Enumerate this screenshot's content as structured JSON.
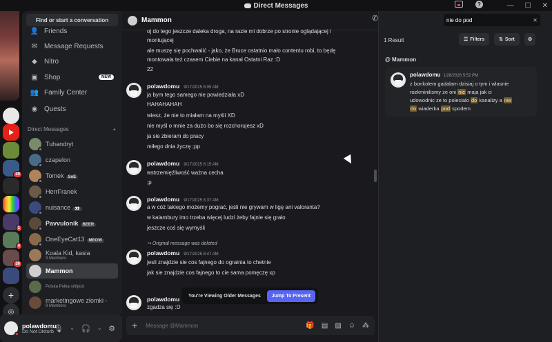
{
  "titlebar": {
    "title": "Direct Messages"
  },
  "sidebar": {
    "find_label": "Find or start a conversation",
    "nav": [
      {
        "label": "Friends",
        "icon": "friends-icon"
      },
      {
        "label": "Message Requests",
        "icon": "mail-icon"
      },
      {
        "label": "Nitro",
        "icon": "nitro-icon"
      },
      {
        "label": "Shop",
        "icon": "shop-icon",
        "badge": "NEW"
      },
      {
        "label": "Family Center",
        "icon": "family-icon"
      },
      {
        "label": "Quests",
        "icon": "quests-icon"
      }
    ],
    "dm_header": "Direct Messages",
    "dm_add": "+",
    "dms": [
      {
        "name": "Tuhandryt",
        "color": "#7a8a6a"
      },
      {
        "name": "czapelon",
        "color": "#4a6a8a"
      },
      {
        "name": "Tomek",
        "tag": "SoE",
        "color": "#b0835a"
      },
      {
        "name": "HerrFranek",
        "color": "#6a5a4a"
      },
      {
        "name": "nuisance",
        "tag": "👀",
        "color": "#3a4a7a"
      },
      {
        "name": "Pavvulonik",
        "tag": "BEER",
        "color": "#5a4a3a"
      },
      {
        "name": "OneEyeCat13",
        "tag": "MEOW",
        "color": "#8a6a4a"
      },
      {
        "name": "Koala Kid, kasia",
        "sub": "3 Members",
        "color": "#9a7a5a"
      },
      {
        "name": "Mammon",
        "color": "#d0d0d0"
      },
      {
        "name": "Polska Polka strilpod",
        "color": "#5a6a4a"
      },
      {
        "name": "marketingowe złomki -",
        "sub": "9 Members",
        "color": "#6a4a3a"
      }
    ]
  },
  "user": {
    "name": "polawdomu",
    "status": "Do Not Disturb"
  },
  "chat": {
    "header_name": "Mammon",
    "composer_placeholder": "Message @Mammon",
    "older_text": "You're Viewing Older Messages",
    "jump_label": "Jump To Present",
    "reply_text": "Original message was deleted",
    "messages": [
      {
        "lines": [
          "oj do tego jeszcze daleka droga, na razie mi dobrze po stronie oglądającej i",
          "montującej",
          "ale muszę się pochwalić - jako, że Bruce ostatnio mało contentu robi, to będę",
          "montowała też czasem  Ciebie na kanał Ostatni Raz :D",
          "22"
        ]
      },
      {
        "user": "polawdomu",
        "time": "9/17/2025 8:05 AM",
        "lines": [
          "ja bym tego samego nie powiedziała xD",
          "HAHAHAHAH",
          "wiesz, że nie to miałam na myśli XD",
          "nie myśl o mnie za dużo bo się rozchorujesz xD",
          "ja sie zbieram do pracy",
          "miłego dnia życzę ;pp"
        ]
      },
      {
        "user": "polawdomu",
        "time": "9/17/2025 8:15 AM",
        "lines": [
          "wstrzemięźliwość ważna cecha",
          ";p"
        ]
      },
      {
        "user": "polawdomu",
        "time": "9/17/2025 8:37 AM",
        "lines": [
          "a w cóż takiego możemy pograć, jeśli nie grywam w ligę ani valoranta?",
          "w kalambury imo trzeba więcej ludzi żeby fajnie się grało",
          "jeszcze coś się wymyśli"
        ]
      },
      {
        "user": "polawdomu",
        "time": "9/17/2025 8:47 AM",
        "lines": [
          "jesli znajdzie sie cos fajnego do ograinia to chetnie",
          "jak sie znajdzie cos fajnego to cie sama pomęczę xp"
        ]
      },
      {
        "user": "polawdomu",
        "time": "",
        "lines": [
          "zgadza się :D"
        ]
      }
    ]
  },
  "search": {
    "query": "nie do pod",
    "results_count": "1 Result",
    "filters_label": "Filters",
    "sort_label": "Sort",
    "group": "Mammon",
    "result": {
      "user": "polawdomu",
      "time": "1/28/2026 5:52 PM",
      "line1": "z bonkolem gadalam dzisiaj o tym i wlasnie",
      "line2a": "rozkminilismy ze oni ",
      "line2hl": "nie",
      "line2b": " maja jak ci",
      "line3a": "udowodnic ze to polecialo ",
      "line3hl1": "do",
      "line3b": " kanalizy a ",
      "line3hl2": "nie",
      "line4hl1": "do",
      "line4b": " wiaderka ",
      "line4hl2": "pod",
      "line4c": " spodem"
    }
  }
}
